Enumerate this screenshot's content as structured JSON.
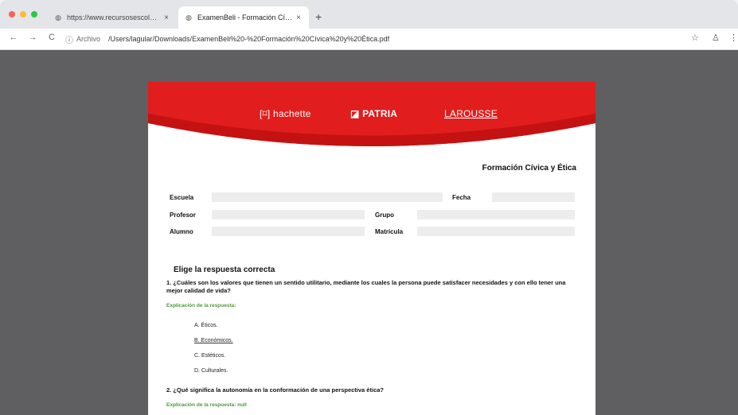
{
  "browser": {
    "tabs": [
      {
        "title": "https://www.recursosescolares...",
        "active": false
      },
      {
        "title": "ExamenBeli - Formación Cívica...",
        "active": true
      }
    ],
    "new_tab_symbol": "+",
    "close_symbol": "×",
    "nav": {
      "back": "←",
      "forward": "→",
      "reload": "C"
    },
    "address": {
      "info_icon": "ⓘ",
      "label": "Archivo",
      "url": "/Users/lagular/Downloads/ExamenBeli%20-%20Formación%20Cívica%20y%20Ética.pdf"
    },
    "toolbar_icons": {
      "star": "☆",
      "profile": "♙",
      "menu": "⋮"
    },
    "traffic_light_colors": [
      "#ff5f57",
      "#febc2e",
      "#28c840"
    ]
  },
  "pdf": {
    "logos": {
      "hachette": "hachette",
      "patria": "PATRIA",
      "larousse": "LAROUSSE"
    },
    "subject": "Formación Cívica y Ética",
    "fields": {
      "escuela": "Escuela",
      "fecha": "Fecha",
      "profesor": "Profesor",
      "grupo": "Grupo",
      "alumno": "Alumno",
      "matricula": "Matrícula"
    },
    "section_title": "Elige la respuesta correcta",
    "q1": {
      "text": "1. ¿Cuáles son los valores que tienen un sentido utilitario, mediante los cuales la persona puede satisfacer necesidades y con ello tener una mejor calidad de vida?",
      "hint": "Explicación de la respuesta:",
      "options": [
        "A. Éticos.",
        "B. Económicos.",
        "C. Estéticos.",
        "D. Culturales."
      ]
    },
    "q2": {
      "text": "2. ¿Qué significa la autonomía en la conformación de una perspectiva ética?",
      "hint": "Explicación de la respuesta: null"
    },
    "colors": {
      "brand_red": "#e11d1d",
      "hint_green": "#4a9a3a",
      "viewer_bg": "#5f5f61"
    }
  }
}
